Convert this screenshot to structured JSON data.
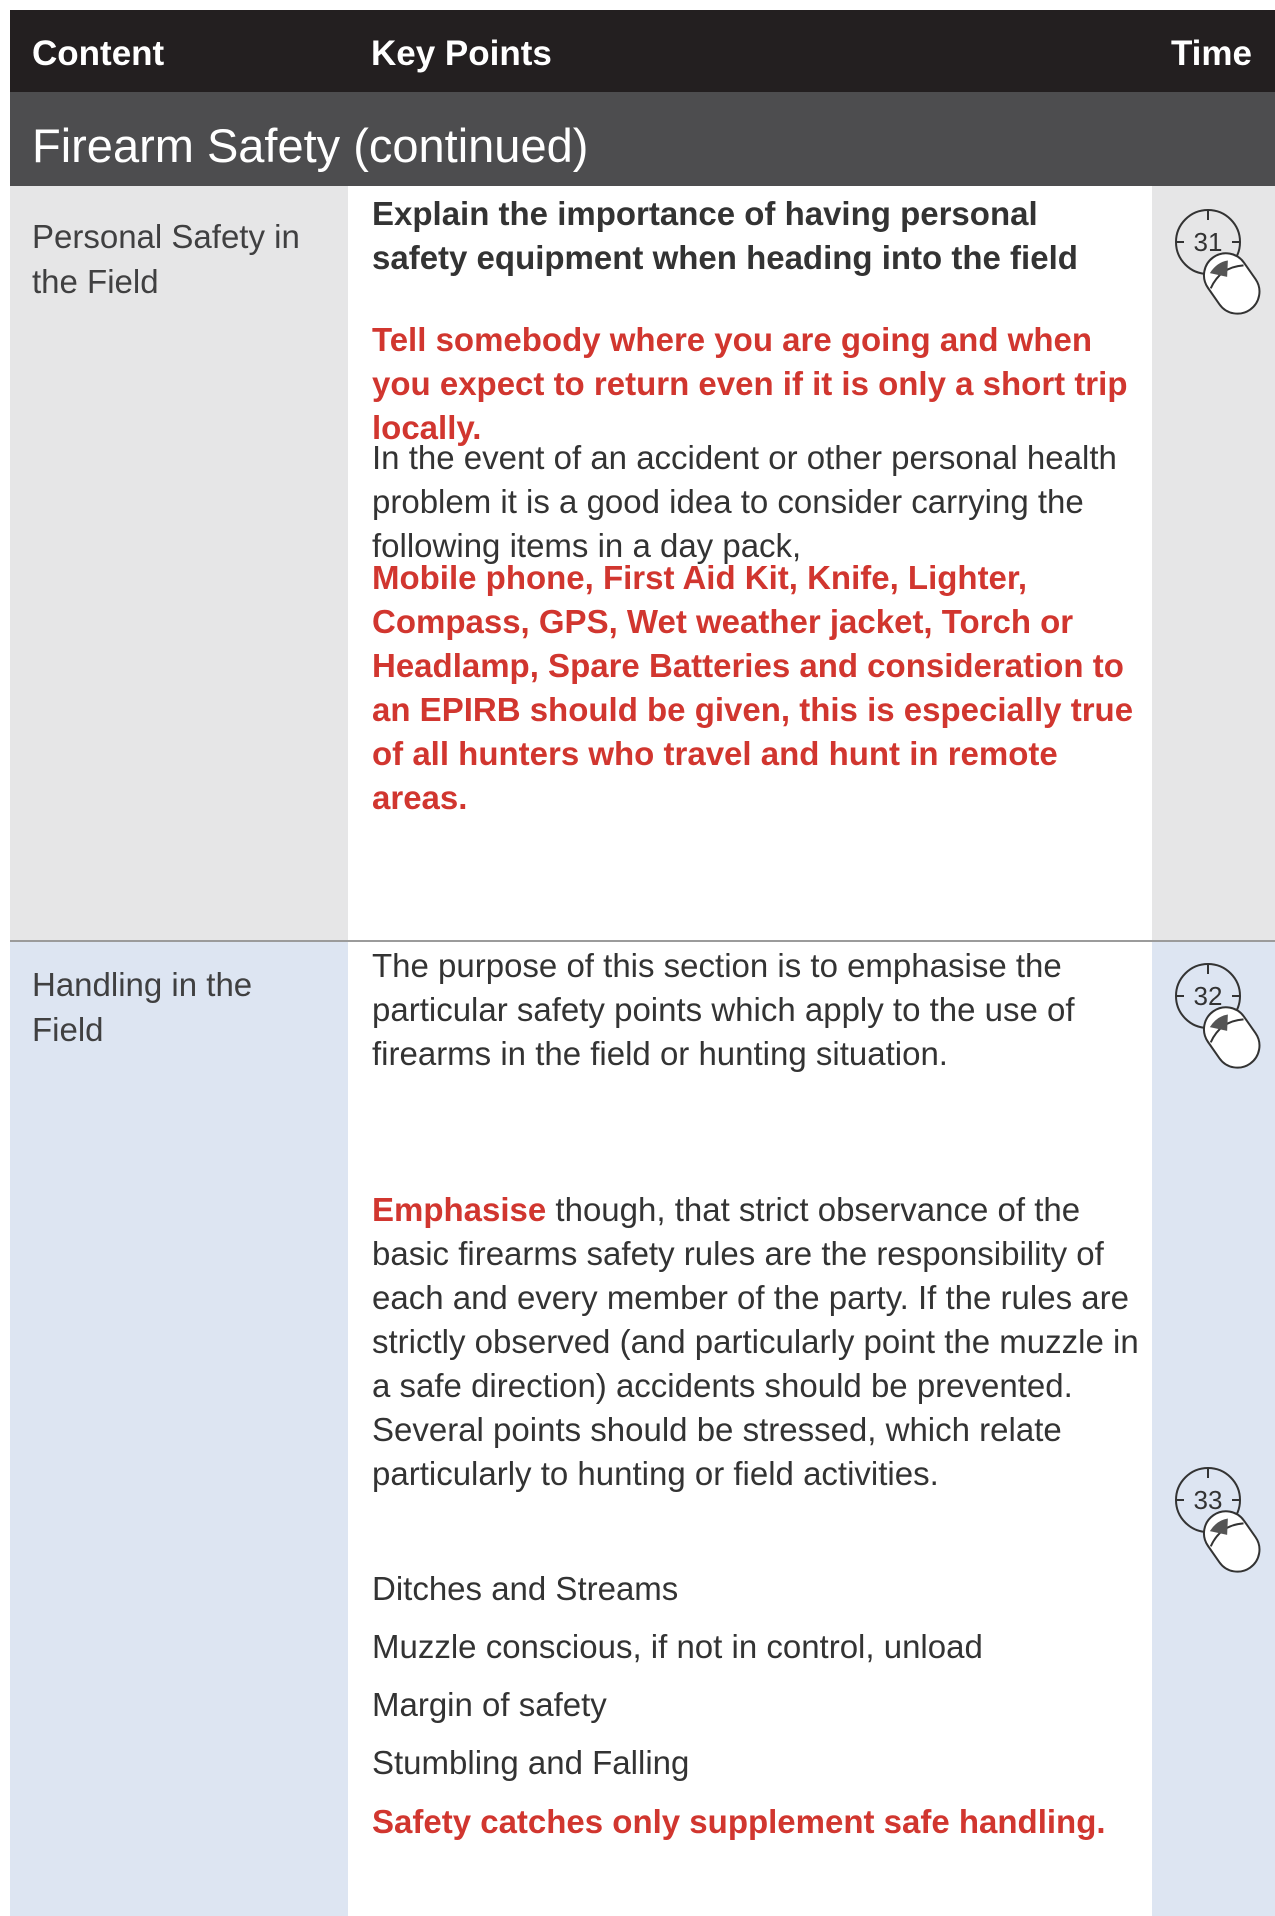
{
  "header": {
    "content_label": "Content",
    "keypoints_label": "Key Points",
    "time_label": "Time"
  },
  "section": {
    "title": "Firearm Safety (continued)"
  },
  "rows": [
    {
      "content": "Personal Safety in the Field",
      "paragraphs": [
        "Explain the importance of having personal safety equipment when heading into the field",
        "Tell somebody where you are going and when you expect to return even if it is only a short trip locally.",
        "In the event of an accident or other personal health problem it is a good idea to consider carrying the following items in a day pack,",
        "Mobile phone, First Aid Kit, Knife, Lighter, Compass, GPS, Wet weather jacket, Torch or Headlamp, Spare Batteries and consideration to an EPIRB should be given, this is especially true of all hunters who travel and hunt in remote areas."
      ],
      "time_markers": [
        "31"
      ]
    },
    {
      "content": "Handling in the Field",
      "paragraphs": [
        "The purpose of this section is to emphasise the particular safety points which apply to the use of firearms in the field or hunting situation.",
        "though, that strict observance of the basic firearms safety rules are the responsibility of each and every member of the party. If the rules are strictly observed (and particularly point the muzzle in a safe direction) accidents should be prevented. Several points should be stressed, which relate particularly to hunting or field activities.",
        "Ditches and Streams",
        "Muzzle conscious, if not in control, unload",
        "Margin of safety",
        "Stumbling and Falling",
        "Safety catches only supplement safe handling."
      ],
      "emphasis_word": "Emphasise",
      "time_markers": [
        "32",
        "33"
      ]
    }
  ],
  "icon": "clock-mouse-icon",
  "colors": {
    "header_bg": "#231f20",
    "section_bg": "#4d4d4f",
    "row1_bg": "#e6e6e7",
    "row2_bg": "#dde5f2",
    "emphasis_red": "#d1362f"
  }
}
